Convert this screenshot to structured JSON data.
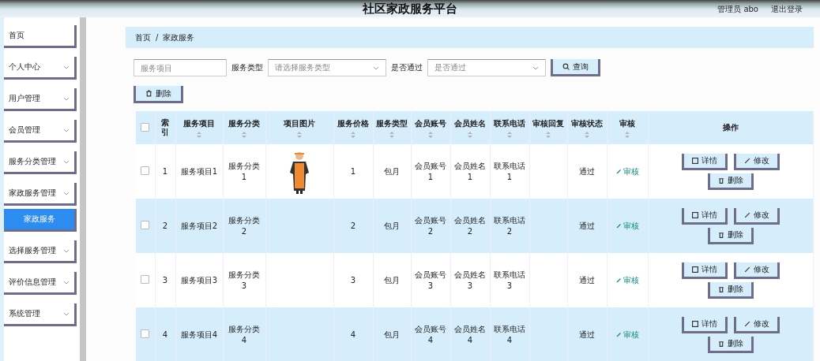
{
  "header": {
    "title": "社区家政服务平台",
    "user": "管理员 abo",
    "logout": "退出登录"
  },
  "sidebar": {
    "items": [
      {
        "label": "首页",
        "expandable": false,
        "selected": false
      },
      {
        "label": "个人中心",
        "expandable": true,
        "selected": false
      },
      {
        "label": "用户管理",
        "expandable": true,
        "selected": false
      },
      {
        "label": "会员管理",
        "expandable": true,
        "selected": false
      },
      {
        "label": "服务分类管理",
        "expandable": true,
        "selected": false
      },
      {
        "label": "家政服务管理",
        "expandable": true,
        "selected": false,
        "children": [
          {
            "label": "家政服务",
            "selected": true
          }
        ]
      },
      {
        "label": "选择服务管理",
        "expandable": true,
        "selected": false
      },
      {
        "label": "评价信息管理",
        "expandable": true,
        "selected": false
      },
      {
        "label": "系统管理",
        "expandable": true,
        "selected": false
      }
    ]
  },
  "breadcrumb": {
    "items": [
      "首页",
      "家政服务"
    ],
    "separator": "/"
  },
  "search": {
    "fields": [
      {
        "kind": "input",
        "placeholder": "服务项目"
      },
      {
        "kind": "select",
        "label": "服务类型",
        "placeholder": "请选择服务类型"
      },
      {
        "kind": "select",
        "label": "是否通过",
        "placeholder": "是否通过"
      }
    ],
    "button": "查询"
  },
  "toolbar": {
    "delete_button": "删除"
  },
  "table": {
    "all_checked": false,
    "columns": [
      {
        "label": "索引",
        "sortable": false
      },
      {
        "label": "服务项目",
        "sortable": true
      },
      {
        "label": "服务分类",
        "sortable": true
      },
      {
        "label": "项目图片",
        "sortable": true
      },
      {
        "label": "服务价格",
        "sortable": true
      },
      {
        "label": "服务类型",
        "sortable": true
      },
      {
        "label": "会员账号",
        "sortable": true
      },
      {
        "label": "会员姓名",
        "sortable": true
      },
      {
        "label": "联系电话",
        "sortable": true
      },
      {
        "label": "审核回复",
        "sortable": true
      },
      {
        "label": "审核状态",
        "sortable": true
      },
      {
        "label": "审核",
        "sortable": true
      },
      {
        "label": "操作",
        "sortable": false
      }
    ],
    "rows": [
      {
        "checked": false,
        "index": "1",
        "item": "服务项目1",
        "category": "服务分类1",
        "image": {
          "kind": "picture"
        },
        "price": "1",
        "type": "包月",
        "account": "会员账号1",
        "name": "会员姓名1",
        "phone": "联系电话1",
        "status": "通过",
        "audit": "审核",
        "actions": [
          "详情",
          "修改",
          "删除"
        ]
      },
      {
        "checked": false,
        "index": "2",
        "item": "服务项目2",
        "category": "服务分类2",
        "price": "2",
        "type": "包月",
        "account": "会员账号2",
        "name": "会员姓名2",
        "phone": "联系电话2",
        "status": "通过",
        "audit": "审核",
        "actions": [
          "详情",
          "修改",
          "删除"
        ]
      },
      {
        "checked": false,
        "index": "3",
        "item": "服务项目3",
        "category": "服务分类3",
        "price": "3",
        "type": "包月",
        "account": "会员账号3",
        "name": "会员姓名3",
        "phone": "联系电话3",
        "status": "通过",
        "audit": "审核",
        "actions": [
          "详情",
          "修改",
          "删除"
        ]
      },
      {
        "checked": false,
        "index": "4",
        "item": "服务项目4",
        "category": "服务分类4",
        "price": "4",
        "type": "包月",
        "account": "会员账号4",
        "name": "会员姓名4",
        "phone": "联系电话4",
        "status": "通过",
        "audit": "审核",
        "actions": [
          "详情",
          "修改",
          "删除"
        ]
      }
    ]
  }
}
